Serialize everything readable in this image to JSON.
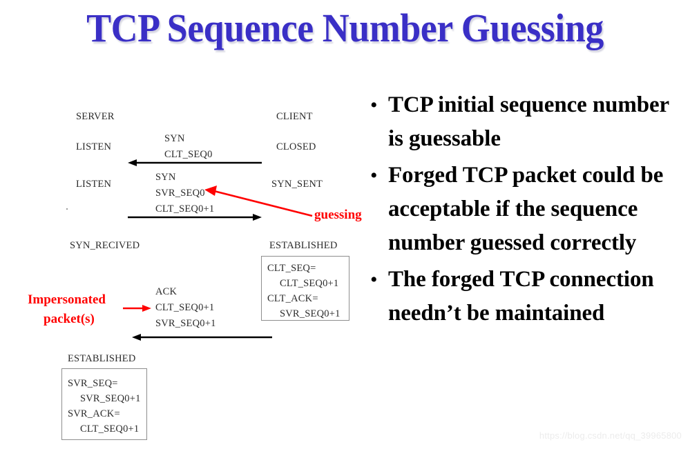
{
  "slide": {
    "title": "TCP Sequence Number Guessing",
    "title_color": "#3a2fc6",
    "background_color": "#ffffff",
    "accent_red": "#ff0000",
    "watermark": "https://blog.csdn.net/qq_39965800"
  },
  "diagram": {
    "columns": {
      "server": "SERVER",
      "client": "CLIENT"
    },
    "server_states": {
      "s1": "LISTEN",
      "s2": "LISTEN",
      "s3": "SYN_RECIVED",
      "s4": "ESTABLISHED"
    },
    "client_states": {
      "c1": "CLOSED",
      "c2": "SYN_SENT",
      "c3": "ESTABLISHED"
    },
    "messages": {
      "m1": {
        "l1": "SYN",
        "l2": "CLT_SEQ0"
      },
      "m2": {
        "l1": "SYN",
        "l2": "SVR_SEQ0",
        "l3": "CLT_SEQ0+1"
      },
      "m3": {
        "l1": "ACK",
        "l2": "CLT_SEQ0+1",
        "l3": "SVR_SEQ0+1"
      }
    },
    "annotations": {
      "guessing": "guessing",
      "impersonated_line1": "Impersonated",
      "impersonated_line2": "packet(s)"
    },
    "client_box": {
      "l1": "CLT_SEQ=",
      "l2": "CLT_SEQ0+1",
      "l3": "CLT_ACK=",
      "l4": "SVR_SEQ0+1"
    },
    "server_box": {
      "l1": "SVR_SEQ=",
      "l2": "SVR_SEQ0+1",
      "l3": "SVR_ACK=",
      "l4": "CLT_SEQ0+1"
    }
  },
  "bullets": {
    "marker": "•",
    "items": [
      "TCP initial sequence number is guessable",
      "Forged TCP packet could be acceptable if the sequence number guessed correctly",
      "The forged TCP connection needn’t be maintained"
    ]
  }
}
